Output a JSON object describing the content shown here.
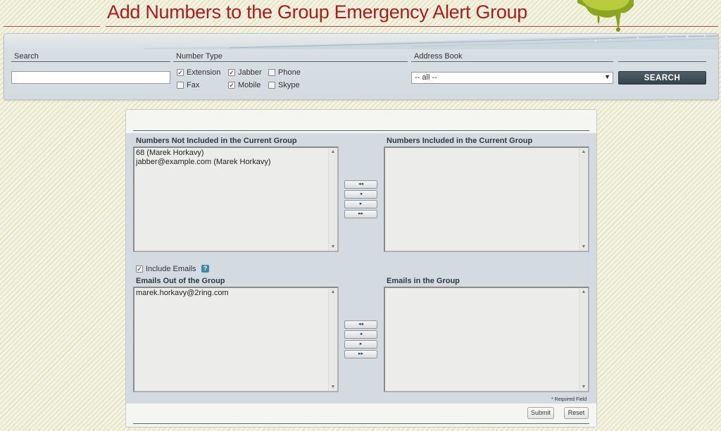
{
  "page": {
    "title": "Add Numbers to the Group Emergency Alert Group"
  },
  "search_panel": {
    "search_label": "Search",
    "search_value": "",
    "number_type_label": "Number Type",
    "number_types": [
      {
        "label": "Extension",
        "checked": true
      },
      {
        "label": "Jabber",
        "checked": true
      },
      {
        "label": "Phone",
        "checked": false
      },
      {
        "label": "Fax",
        "checked": false
      },
      {
        "label": "Mobile",
        "checked": true
      },
      {
        "label": "Skype",
        "checked": false
      }
    ],
    "address_book_label": "Address Book",
    "address_book_selected": "-- all --",
    "search_button": "SEARCH"
  },
  "numbers": {
    "not_included_label": "Numbers Not Included in the Current Group",
    "not_included_items": [
      "68 (Marek Horkavy)",
      "jabber@example.com (Marek Horkavy)"
    ],
    "included_label": "Numbers Included in the Current Group",
    "included_items": []
  },
  "emails": {
    "include_label": "Include Emails",
    "include_checked": true,
    "help": "?",
    "out_label": "Emails Out of the Group",
    "out_items": [
      "marek.horkavy@2ring.com"
    ],
    "in_label": "Emails in the Group",
    "in_items": []
  },
  "move_buttons": {
    "all_left": "◂◂",
    "left": "◂",
    "right": "▸",
    "all_right": "▸▸"
  },
  "footer": {
    "required_note": "* Required Field",
    "submit": "Submit",
    "reset": "Reset"
  },
  "colors": {
    "title": "#a81c1c",
    "panel": "#d3dbe0",
    "search_button": "#3e4d55",
    "help_icon": "#3b8aa8"
  }
}
